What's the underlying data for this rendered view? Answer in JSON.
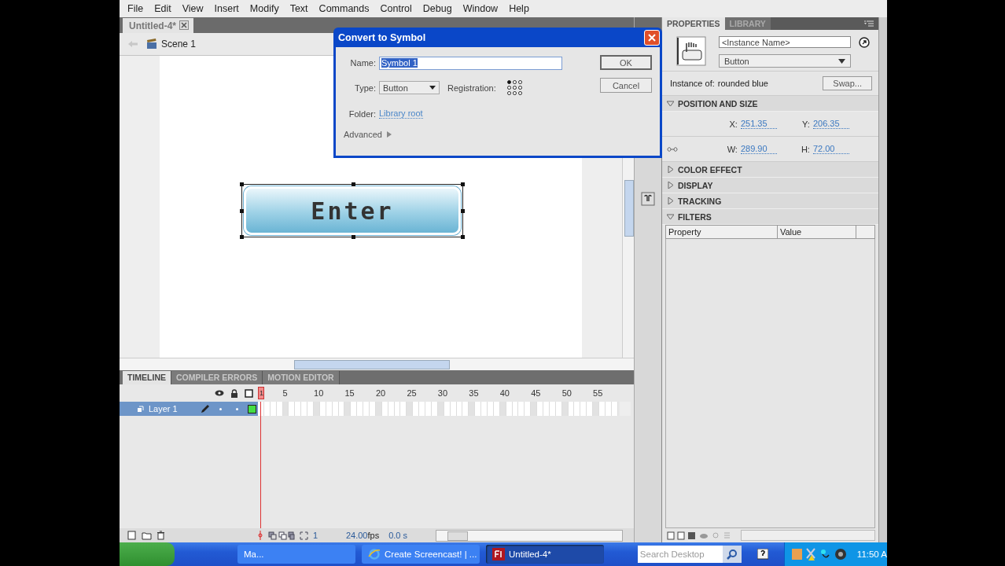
{
  "menu": [
    "File",
    "Edit",
    "View",
    "Insert",
    "Modify",
    "Text",
    "Commands",
    "Control",
    "Debug",
    "Window",
    "Help"
  ],
  "document_tab": {
    "title": "Untitled-4*"
  },
  "edit_bar": {
    "scene": "Scene 1"
  },
  "stage": {
    "symbol_label": "Enter"
  },
  "dialog": {
    "title": "Convert to Symbol",
    "name_label": "Name:",
    "name_value": "Symbol 1",
    "type_label": "Type:",
    "type_value": "Button",
    "registration_label": "Registration:",
    "folder_label": "Folder:",
    "folder_link": "Library root",
    "advanced": "Advanced",
    "ok": "OK",
    "cancel": "Cancel",
    "registration_points": [
      {
        "selected": true
      },
      {
        "selected": false
      },
      {
        "selected": false
      },
      {
        "selected": false
      },
      {
        "selected": false
      },
      {
        "selected": false
      },
      {
        "selected": false
      },
      {
        "selected": false
      },
      {
        "selected": false
      }
    ]
  },
  "properties": {
    "tabs": [
      {
        "label": "PROPERTIES",
        "selected": true
      },
      {
        "label": "LIBRARY",
        "selected": false
      }
    ],
    "instance_name_placeholder": "<Instance Name>",
    "behavior": "Button",
    "instance_of_label": "Instance of:",
    "instance_of": "rounded blue",
    "swap": "Swap...",
    "sections": [
      {
        "title": "POSITION AND SIZE",
        "expanded": true,
        "fields": [
          {
            "label": "X:",
            "value": "251.35"
          },
          {
            "label": "Y:",
            "value": "206.35"
          },
          {
            "label": "W:",
            "value": "289.90"
          },
          {
            "label": "H:",
            "value": "72.00"
          }
        ]
      },
      {
        "title": "COLOR EFFECT",
        "expanded": false
      },
      {
        "title": "DISPLAY",
        "expanded": false
      },
      {
        "title": "TRACKING",
        "expanded": false
      },
      {
        "title": "FILTERS",
        "expanded": true,
        "columns": [
          "Property",
          "Value"
        ]
      }
    ]
  },
  "timeline": {
    "tabs": [
      {
        "label": "TIMELINE",
        "selected": true
      },
      {
        "label": "COMPILER ERRORS",
        "selected": false
      },
      {
        "label": "MOTION EDITOR",
        "selected": false
      }
    ],
    "ruler": [
      "1",
      "5",
      "10",
      "15",
      "20",
      "25",
      "30",
      "35",
      "40",
      "45",
      "50",
      "55"
    ],
    "layers": [
      {
        "name": "Layer 1",
        "selected": true
      }
    ],
    "footer": {
      "frame": "1",
      "fps": "24.00",
      "fps_unit": "fps",
      "time": "0.0 s"
    }
  },
  "taskbar": {
    "items": [
      {
        "label": "Ma...",
        "selected": false,
        "kind": "folder"
      },
      {
        "label": "Create Screencast! | ...",
        "selected": false,
        "kind": "browser"
      },
      {
        "label": "Untitled-4*",
        "selected": true,
        "kind": "flash"
      }
    ],
    "search_placeholder": "Search Desktop",
    "clock": "11:50 A"
  }
}
